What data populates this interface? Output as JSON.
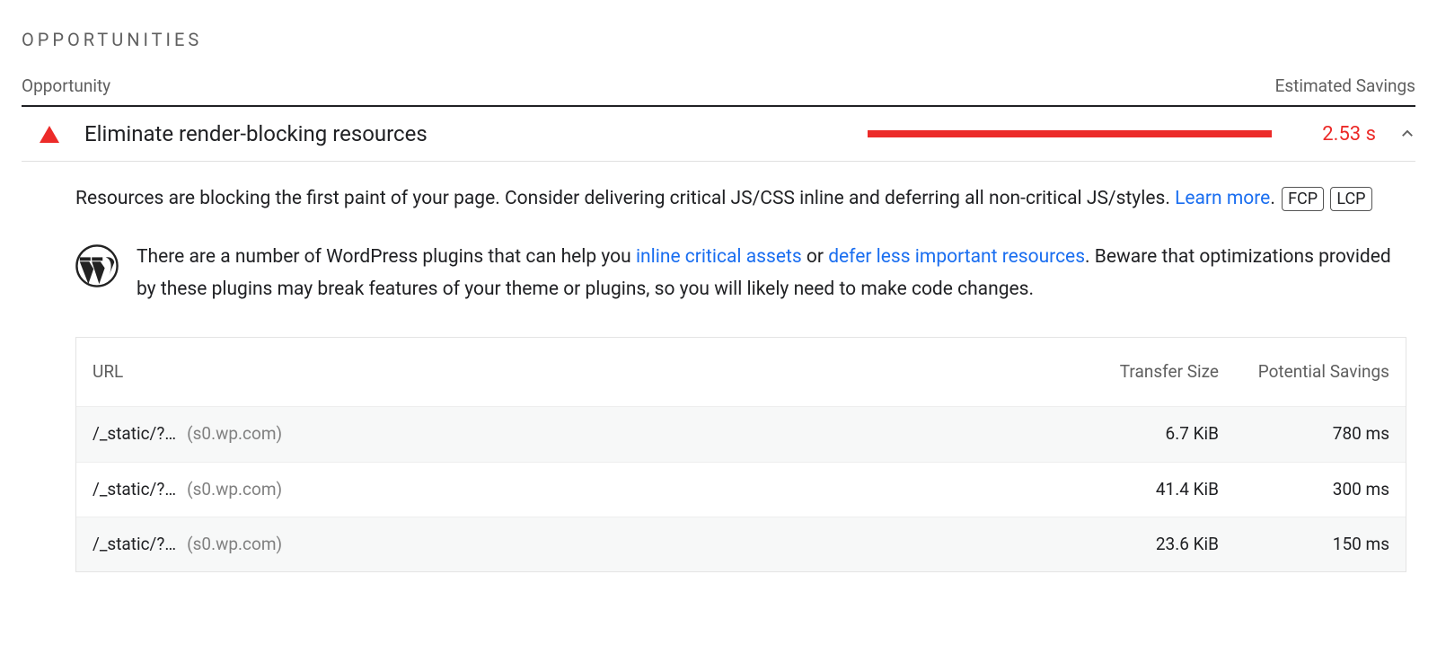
{
  "section_title": "OPPORTUNITIES",
  "header": {
    "left": "Opportunity",
    "right": "Estimated Savings"
  },
  "opportunity": {
    "title": "Eliminate render-blocking resources",
    "savings": "2.53 s"
  },
  "description": {
    "text_before_link": "Resources are blocking the first paint of your page. Consider delivering critical JS/CSS inline and deferring all non-critical JS/styles. ",
    "link_text": "Learn more",
    "period": ".",
    "tag1": "FCP",
    "tag2": "LCP"
  },
  "wp_note": {
    "part1": "There are a number of WordPress plugins that can help you ",
    "link1": "inline critical assets",
    "or": " or ",
    "link2": "defer less important resources",
    "part2": ". Beware that optimizations provided by these plugins may break features of your theme or plugins, so you will likely need to make code changes."
  },
  "table": {
    "head": {
      "url": "URL",
      "size": "Transfer Size",
      "savings": "Potential Savings"
    },
    "rows": [
      {
        "url": "/_static/?…",
        "host": "(s0.wp.com)",
        "size": "6.7 KiB",
        "savings": "780 ms"
      },
      {
        "url": "/_static/?…",
        "host": "(s0.wp.com)",
        "size": "41.4 KiB",
        "savings": "300 ms"
      },
      {
        "url": "/_static/?…",
        "host": "(s0.wp.com)",
        "size": "23.6 KiB",
        "savings": "150 ms"
      }
    ]
  }
}
